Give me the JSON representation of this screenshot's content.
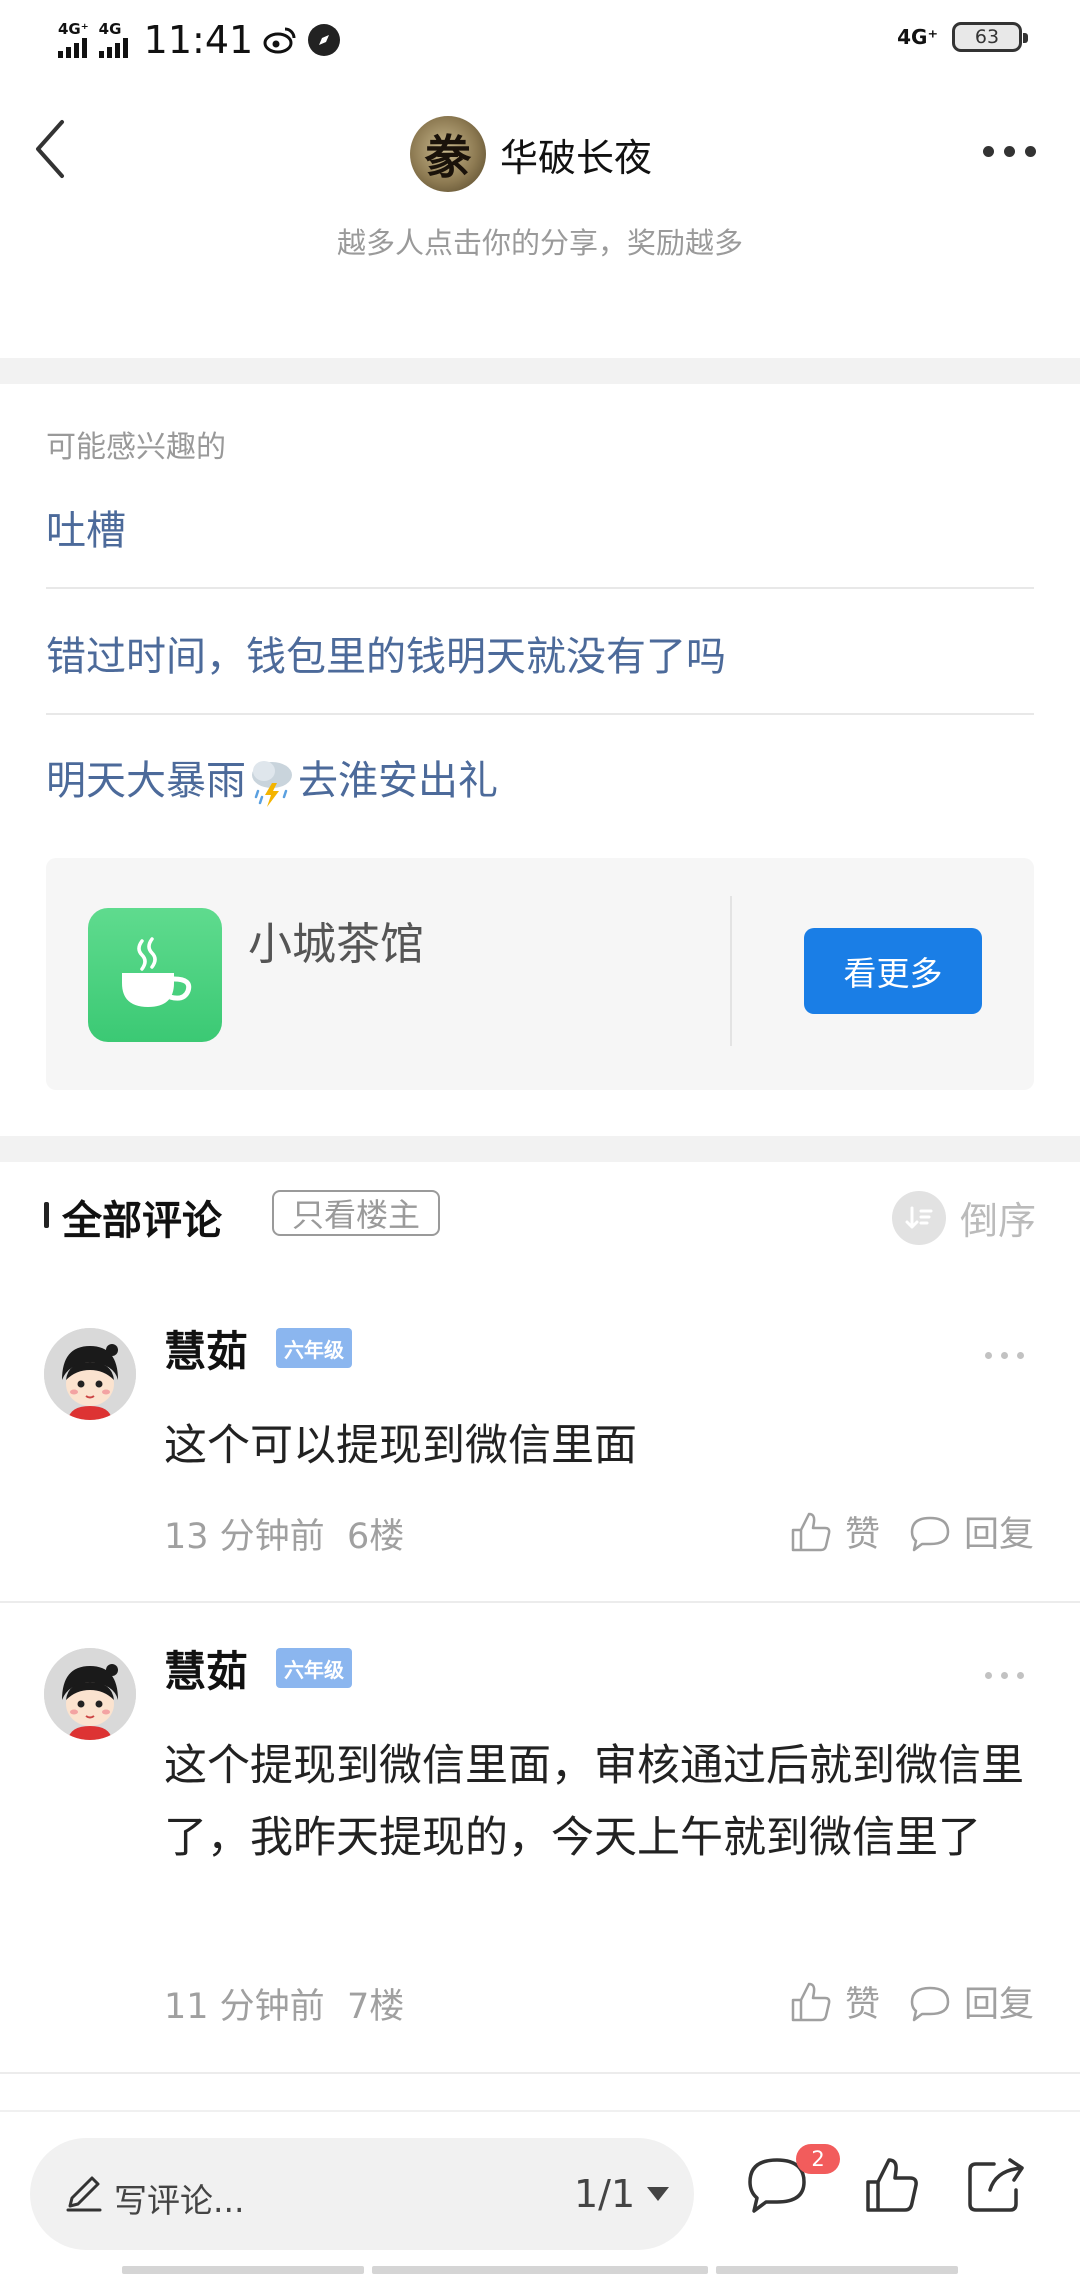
{
  "status_bar": {
    "net1": "4G⁺",
    "net2": "4G",
    "time": "11:41",
    "net_right": "4G⁺",
    "battery": "63"
  },
  "header": {
    "avatar_char": "豢",
    "title": "华破长夜",
    "subtitle": "越多人点击你的分享，奖励越多"
  },
  "interest": {
    "label": "可能感兴趣的",
    "items": [
      {
        "text": "吐槽"
      },
      {
        "text": "错过时间，钱包里的钱明天就没有了吗"
      },
      {
        "text_before": "明天大暴雨",
        "text_after": "去淮安出礼"
      }
    ],
    "card": {
      "name": "小城茶馆",
      "button": "看更多"
    }
  },
  "comments_header": {
    "title": "全部评论",
    "filter": "只看楼主",
    "sort": "倒序"
  },
  "comments": [
    {
      "user": "慧茹",
      "level": "六年级",
      "text": "这个可以提现到微信里面",
      "time": "13 分钟前",
      "floor": "6楼",
      "like": "赞",
      "reply": "回复"
    },
    {
      "user": "慧茹",
      "level": "六年级",
      "text": "这个提现到微信里面，审核通过后就到微信里了，我昨天提现的，今天上午就到微信里了",
      "time": "11 分钟前",
      "floor": "7楼",
      "like": "赞",
      "reply": "回复"
    }
  ],
  "bottom_bar": {
    "placeholder": "写评论...",
    "pager": "1/1",
    "comment_badge": "2"
  },
  "colors": {
    "link_blue": "#4c6a9a",
    "button_blue": "#1a7ee6",
    "badge_red": "#f25c5c",
    "level_blue": "#8bb6ef",
    "teahouse_green": "#3bc974"
  }
}
